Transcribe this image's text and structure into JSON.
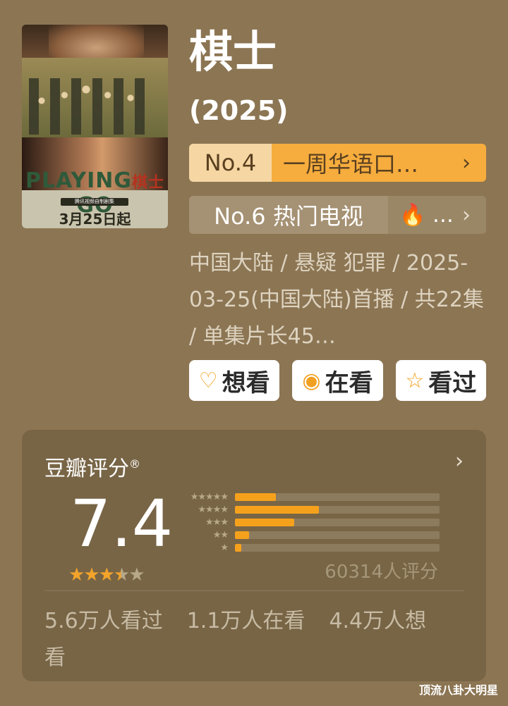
{
  "poster": {
    "title_en_a": "PLAYING",
    "title_zh": "棋士",
    "title_en_b": "GO",
    "tag": "腾讯视频自制剧集",
    "date": "3月25日起"
  },
  "header": {
    "title": "棋士",
    "year": "(2025)"
  },
  "rankings": [
    {
      "number": "No.4",
      "label": "一周华语口…",
      "chevron": "›"
    },
    {
      "number": "No.6 热门电视",
      "extra": "🔥 …",
      "chevron": "›"
    }
  ],
  "meta": {
    "text": "中国大陆 / 悬疑 犯罪 / 2025-03-25(中国大陆)首播 / 共22集 / 单集片长45…"
  },
  "actions": [
    {
      "label": "想看",
      "icon": "heart-plus-icon"
    },
    {
      "label": "在看",
      "icon": "target-circle-icon"
    },
    {
      "label": "看过",
      "icon": "star-outline-icon"
    }
  ],
  "rating": {
    "header": "豆瓣评分",
    "registered": "®",
    "score": "7.4",
    "stars_value": 3.5,
    "distribution": [
      {
        "stars": "★★★★★",
        "percent": 20
      },
      {
        "stars": "★★★★",
        "percent": 41
      },
      {
        "stars": "★★★",
        "percent": 29
      },
      {
        "stars": "★★",
        "percent": 7
      },
      {
        "stars": "★",
        "percent": 3
      }
    ],
    "count_label": "60314人评分"
  },
  "watch_stats": {
    "watched": "5.6万人看过",
    "watching": "1.1万人在看",
    "wish": "4.4万人想看"
  },
  "watermark": "顶流八卦大明星",
  "colors": {
    "background": "#8c7553",
    "accent": "#f6a11c",
    "card": "#786546"
  }
}
